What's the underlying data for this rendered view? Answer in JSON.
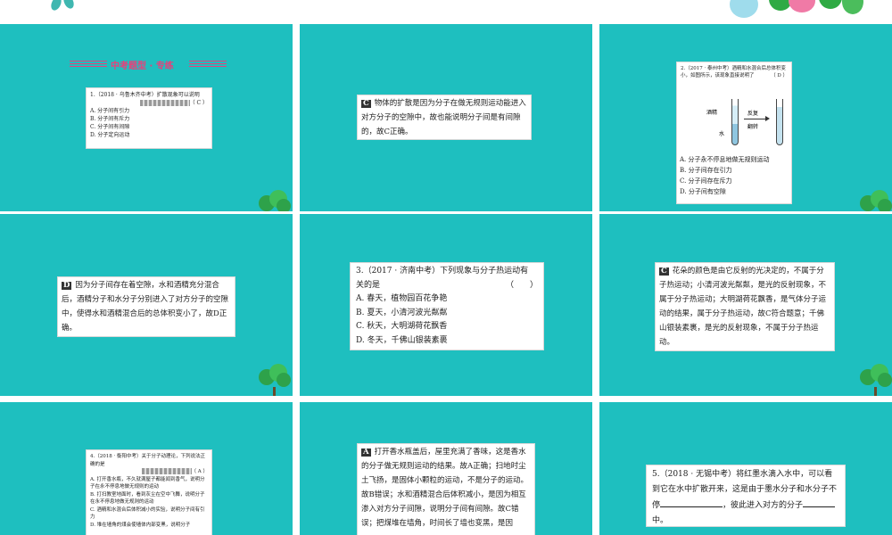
{
  "colors": {
    "slide_bg": "#1ebfbf",
    "header_stripe": "#e8407a",
    "card_bg": "#ffffff"
  },
  "slide1": {
    "header": "中考题型 · 专练",
    "question": "1.（2018 · 乌鲁木齐中考）扩散现象可以说明",
    "answer": "（ C ）",
    "options": [
      "A. 分子间有引力",
      "B. 分子间有斥力",
      "C. 分子间有间隙",
      "D. 分子定向运动"
    ]
  },
  "slide2": {
    "answer_letter": "C",
    "text": "物体的扩散是因为分子在做无规则运动能进入对方分子的空隙中，故也能说明分子间是有间隙的，故C正确。"
  },
  "slide3": {
    "question": "2.（2017 · 泰州中考）酒精和水混合后总体积变小，如图所示，该现象直接说明了",
    "answer": "（ D ）",
    "figure_labels": {
      "alcohol": "酒精",
      "water": "水",
      "action_top": "反复",
      "action_bottom": "翻转"
    },
    "options": [
      "A. 分子永不停息地做无规则运动",
      "B. 分子间存在引力",
      "C. 分子间存在斥力",
      "D. 分子间有空隙"
    ]
  },
  "slide4": {
    "answer_letter": "D",
    "text": "因为分子间存在着空隙，水和酒精充分混合后，酒精分子和水分子分别进入了对方分子的空隙中，使得水和酒精混合后的总体积变小了，故D正确。"
  },
  "slide5": {
    "question_line1": "3.（2017 · 济南中考）下列现象与分子热运动有",
    "question_line2": "关的是",
    "paren": "（　　）",
    "options": [
      "A. 春天，植物园百花争艳",
      "B. 夏天，小清河波光粼粼",
      "C. 秋天，大明湖荷花飘香",
      "D. 冬天，千佛山银装素裹"
    ]
  },
  "slide6": {
    "answer_letter": "C",
    "text": "花朵的颜色是由它反射的光决定的，不属于分子热运动；小清河波光粼粼，是光的反射现象，不属于分子热运动；大明湖荷花飘香，是气体分子运动的结果，属于分子热运动，故C符合题意；千佛山银装素裹，是光的反射现象，不属于分子热运动。"
  },
  "slide7": {
    "question": "4.（2018 · 衡阳中考）关于分子动理论，下列说法正确的是",
    "answer": "（ A ）",
    "options": [
      "A. 打开香水瓶，不久就满屋子都能闻到香气，说明分子在永不停息地做无规则的运动",
      "B. 打扫教室地面时，看到灰尘在空中飞舞，说明分子在永不停息地做无规则的运动",
      "C. 酒精和水混合后体积减小的实验，说明分子间有引力",
      "D. 堆在墙角的煤会使墙体内部变黑，说明分子"
    ]
  },
  "slide8": {
    "answer_letter": "A",
    "text": "打开香水瓶盖后，屋里充满了香味，这是香水的分子做无规则运动的结果。故A正确；扫地时尘土飞扬，是固体小颗粒的运动，不是分子的运动。故B错误；水和酒精混合后体积减小，是因为相互渗入对方分子间隙，说明分子间有间隙。故C错误；把煤堆在墙角，时间长了墙也变黑，是因"
  },
  "slide9": {
    "q_part1": "5.（2018 · 无锡中考）将红墨水滴入水中，可以看到它在水中扩散开来，这是由于墨水分子和水分子不停",
    "q_part2": "，彼此进入对方的分子",
    "q_part3": "中。"
  }
}
